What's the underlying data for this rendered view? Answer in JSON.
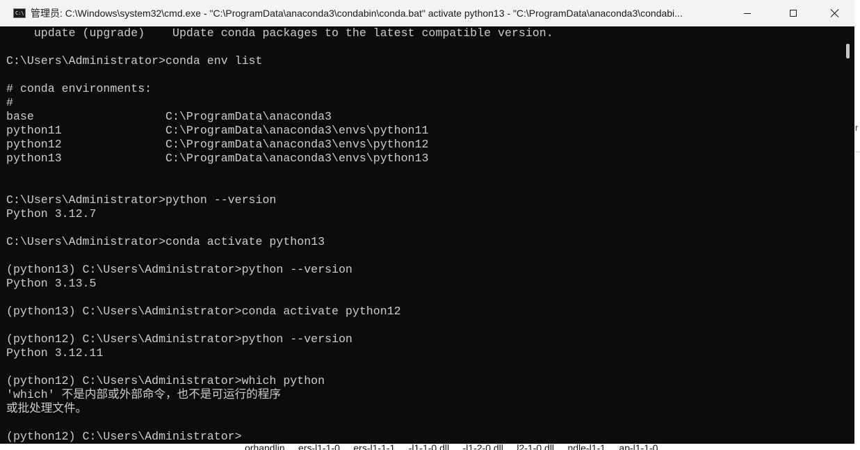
{
  "window": {
    "title": "管理员: C:\\Windows\\system32\\cmd.exe - \"C:\\ProgramData\\anaconda3\\condabin\\conda.bat\"  activate python13 - \"C:\\ProgramData\\anaconda3\\condabi...",
    "icon_text": "C:\\",
    "controls": {
      "minimize": "minimize-icon",
      "maximize": "maximize-icon",
      "close": "close-icon"
    }
  },
  "console": {
    "lines": [
      "    update (upgrade)    Update conda packages to the latest compatible version.",
      "",
      "C:\\Users\\Administrator>conda env list",
      "",
      "# conda environments:",
      "#",
      "base                   C:\\ProgramData\\anaconda3",
      "python11               C:\\ProgramData\\anaconda3\\envs\\python11",
      "python12               C:\\ProgramData\\anaconda3\\envs\\python12",
      "python13               C:\\ProgramData\\anaconda3\\envs\\python13",
      "",
      "",
      "C:\\Users\\Administrator>python --version",
      "Python 3.12.7",
      "",
      "C:\\Users\\Administrator>conda activate python13",
      "",
      "(python13) C:\\Users\\Administrator>python --version",
      "Python 3.13.5",
      "",
      "(python13) C:\\Users\\Administrator>conda activate python12",
      "",
      "(python12) C:\\Users\\Administrator>python --version",
      "Python 3.12.11",
      "",
      "(python12) C:\\Users\\Administrator>which python",
      "'which' 不是内部或外部命令，也不是可运行的程序",
      "或批处理文件。",
      "",
      "(python12) C:\\Users\\Administrator>"
    ]
  },
  "background": {
    "files_text": "orhandlin     ers-l1-1-0     ers-l1-1-1     -l1-1-0.dll     -l1-2-0.dll     l2-1-0.dll     ndle-l1-1     ap-l1-1-0",
    "right_glyph": "r"
  },
  "colors": {
    "console_bg": "#0c0c0c",
    "console_fg": "#cccccc",
    "titlebar_bg": "#f3f3f3"
  }
}
